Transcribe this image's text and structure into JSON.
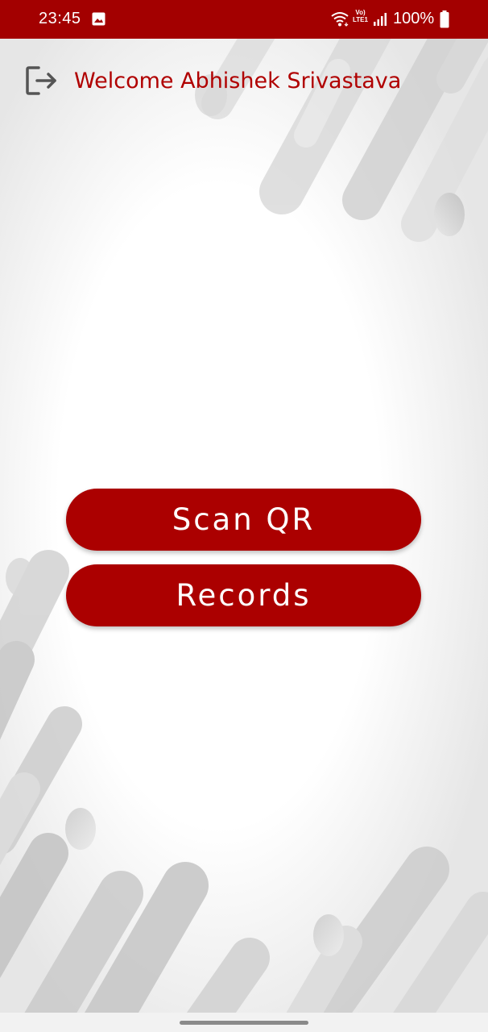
{
  "status_bar": {
    "time": "23:45",
    "battery": "100%",
    "volte_line1": "Vo)",
    "volte_line2": "LTE1",
    "icons": [
      "gallery-icon",
      "wifi-icon",
      "signal-icon",
      "battery-icon"
    ]
  },
  "header": {
    "logout_icon": "logout-icon",
    "welcome_text": "Welcome Abhishek Srivastava"
  },
  "actions": {
    "scan_label": "Scan QR",
    "records_label": "Records"
  },
  "colors": {
    "brand": "#a30000",
    "button": "#ab0000",
    "welcome_text": "#b00000"
  }
}
